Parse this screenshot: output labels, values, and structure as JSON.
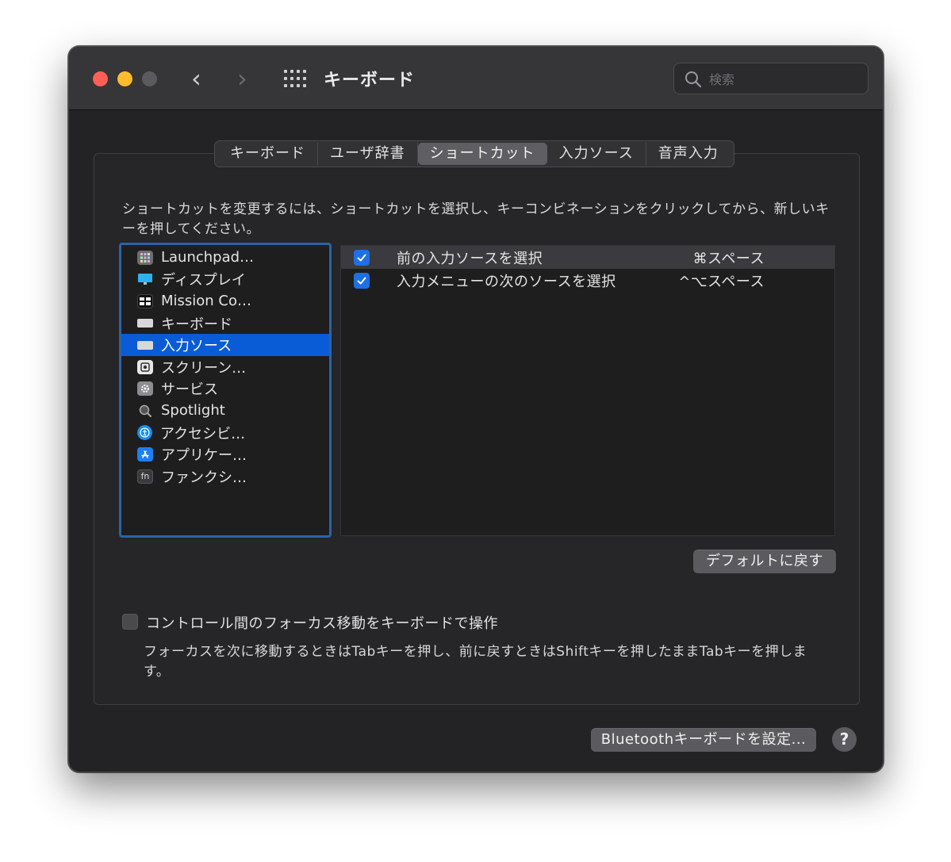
{
  "window": {
    "title": "キーボード"
  },
  "search": {
    "placeholder": "検索"
  },
  "tabs": [
    {
      "label": "キーボード"
    },
    {
      "label": "ユーザ辞書"
    },
    {
      "label": "ショートカット",
      "active": true
    },
    {
      "label": "入力ソース"
    },
    {
      "label": "音声入力"
    }
  ],
  "instructions": "ショートカットを変更するには、ショートカットを選択し、キーコンビネーションをクリックしてから、新しいキーを押してください。",
  "categories": [
    {
      "label": "Launchpad…",
      "icon": "launchpad-icon"
    },
    {
      "label": "ディスプレイ",
      "icon": "display-icon"
    },
    {
      "label": "Mission Co…",
      "icon": "mission-control-icon"
    },
    {
      "label": "キーボード",
      "icon": "keyboard-icon"
    },
    {
      "label": "入力ソース",
      "icon": "input-source-icon",
      "selected": true
    },
    {
      "label": "スクリーン…",
      "icon": "screenshot-icon"
    },
    {
      "label": "サービス",
      "icon": "services-icon"
    },
    {
      "label": "Spotlight",
      "icon": "spotlight-icon"
    },
    {
      "label": "アクセシビ…",
      "icon": "accessibility-icon"
    },
    {
      "label": "アプリケー…",
      "icon": "app-store-icon"
    },
    {
      "label": "ファンクシ…",
      "icon": "fn-key-icon"
    }
  ],
  "shortcuts": [
    {
      "label": "前の入力ソースを選択",
      "key": "⌘スペース",
      "checked": true
    },
    {
      "label": "入力メニューの次のソースを選択",
      "key": "^⌥スペース",
      "checked": true
    }
  ],
  "buttons": {
    "restore_defaults": "デフォルトに戻す",
    "bluetooth_keyboard": "Bluetoothキーボードを設定...",
    "help": "?"
  },
  "focus_option": {
    "label": "コントロール間のフォーカス移動をキーボードで操作",
    "checked": false,
    "description": "フォーカスを次に移動するときはTabキーを押し、前に戻すときはShiftキーを押したままTabキーを押します。"
  },
  "colors": {
    "accent": "#0a5bd6",
    "close": "#fe5f57",
    "minimize": "#febc2e",
    "focus_ring": "#2a64a6"
  }
}
